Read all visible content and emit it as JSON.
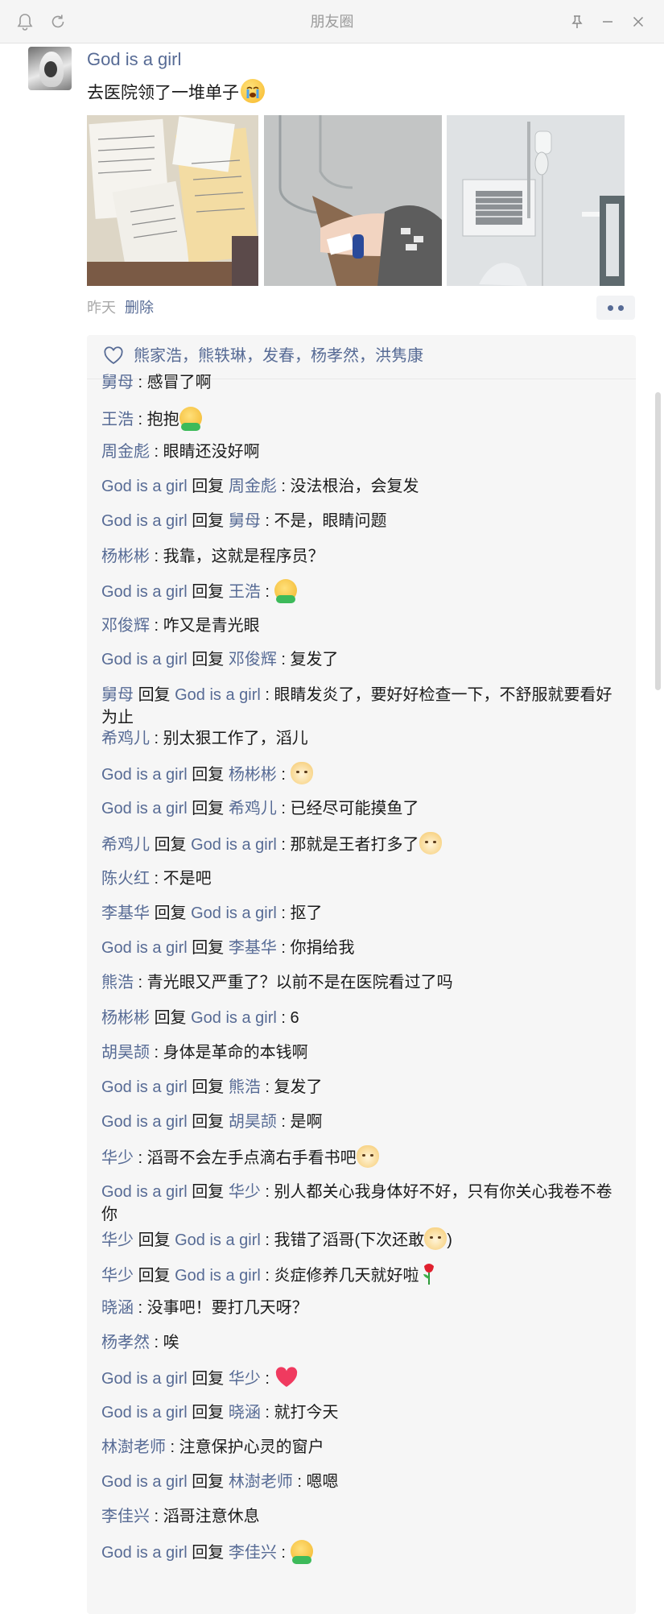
{
  "window": {
    "title": "朋友圈"
  },
  "post": {
    "author": "God is a girl",
    "text": "去医院领了一堆单子",
    "time": "昨天",
    "delete_label": "删除",
    "likes": "熊家浩，熊轶琳，发春，杨孝然，洪隽康"
  },
  "comments": [
    {
      "from": "舅母",
      "text": "感冒了啊"
    },
    {
      "from": "王浩",
      "text": "抱抱",
      "emoji": "hug-emoji"
    },
    {
      "from": "周金彪",
      "text": "眼睛还没好啊"
    },
    {
      "from": "God is a girl",
      "reply_word": "回复",
      "to": "周金彪",
      "text": "没法根治，会复发"
    },
    {
      "from": "God is a girl",
      "reply_word": "回复",
      "to": "舅母",
      "text": "不是，眼睛问题"
    },
    {
      "from": "杨彬彬",
      "text": "我靠，这就是程序员？"
    },
    {
      "from": "God is a girl",
      "reply_word": "回复",
      "to": "王浩",
      "text": "",
      "emoji": "hug-emoji"
    },
    {
      "from": "邓俊辉",
      "text": "咋又是青光眼"
    },
    {
      "from": "God is a girl",
      "reply_word": "回复",
      "to": "邓俊辉",
      "text": "复发了"
    },
    {
      "from": "舅母",
      "reply_word": "回复",
      "to": "God is a girl",
      "text": "眼睛发炎了，要好好检查一下，不舒服就要看好为止"
    },
    {
      "from": "希鸡儿",
      "text": "别太狠工作了，滔儿"
    },
    {
      "from": "God is a girl",
      "reply_word": "回复",
      "to": "杨彬彬",
      "text": "",
      "emoji": "doge-emoji"
    },
    {
      "from": "God is a girl",
      "reply_word": "回复",
      "to": "希鸡儿",
      "text": "已经尽可能摸鱼了"
    },
    {
      "from": "希鸡儿",
      "reply_word": "回复",
      "to": "God is a girl",
      "text": "那就是王者打多了",
      "emoji": "doge-emoji"
    },
    {
      "from": "陈火红",
      "text": "不是吧"
    },
    {
      "from": "李基华",
      "reply_word": "回复",
      "to": "God is a girl",
      "text": "抠了"
    },
    {
      "from": "God is a girl",
      "reply_word": "回复",
      "to": "李基华",
      "text": "你捐给我"
    },
    {
      "from": "熊浩",
      "text": "青光眼又严重了？以前不是在医院看过了吗"
    },
    {
      "from": "杨彬彬",
      "reply_word": "回复",
      "to": "God is a girl",
      "text": "6"
    },
    {
      "from": "胡昊颉",
      "text": "身体是革命的本钱啊"
    },
    {
      "from": "God is a girl",
      "reply_word": "回复",
      "to": "熊浩",
      "text": "复发了"
    },
    {
      "from": "God is a girl",
      "reply_word": "回复",
      "to": "胡昊颉",
      "text": "是啊"
    },
    {
      "from": "华少",
      "text": "滔哥不会左手点滴右手看书吧",
      "emoji": "doge-emoji"
    },
    {
      "from": "God is a girl",
      "reply_word": "回复",
      "to": "华少",
      "text": "别人都关心我身体好不好，只有你关心我卷不卷你"
    },
    {
      "from": "华少",
      "reply_word": "回复",
      "to": "God is a girl",
      "text": "我错了滔哥(下次还敢",
      "emoji": "doge-emoji",
      "text_after": ")"
    },
    {
      "from": "华少",
      "reply_word": "回复",
      "to": "God is a girl",
      "text": "炎症修养几天就好啦",
      "emoji": "rose-emoji"
    },
    {
      "from": "晓涵",
      "text": "没事吧！要打几天呀？"
    },
    {
      "from": "杨孝然",
      "text": "唉"
    },
    {
      "from": "God is a girl",
      "reply_word": "回复",
      "to": "华少",
      "text": "",
      "emoji": "heart-emoji"
    },
    {
      "from": "God is a girl",
      "reply_word": "回复",
      "to": "晓涵",
      "text": "就打今天"
    },
    {
      "from": "林澍老师",
      "text": "注意保护心灵的窗户"
    },
    {
      "from": "God is a girl",
      "reply_word": "回复",
      "to": "林澍老师",
      "text": "嗯嗯"
    },
    {
      "from": "李佳兴",
      "text": "滔哥注意休息"
    },
    {
      "from": "God is a girl",
      "reply_word": "回复",
      "to": "李佳兴",
      "text": "",
      "emoji": "hug-emoji"
    }
  ]
}
